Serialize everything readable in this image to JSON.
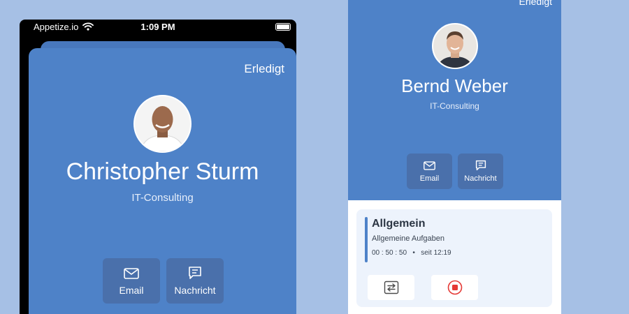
{
  "left_phone": {
    "status_bar": {
      "carrier": "Appetize.io",
      "time": "1:09 PM"
    },
    "done_label": "Erledigt",
    "contact": {
      "name": "Christopher Sturm",
      "department": "IT-Consulting"
    },
    "actions": {
      "email_label": "Email",
      "message_label": "Nachricht"
    }
  },
  "right_phone": {
    "done_label": "Erledigt",
    "contact": {
      "name": "Bernd Weber",
      "department": "IT-Consulting"
    },
    "actions": {
      "email_label": "Email",
      "message_label": "Nachricht"
    },
    "task": {
      "title": "Allgemein",
      "subtitle": "Allgemeine Aufgaben",
      "duration": "00 : 50 : 50",
      "separator": "•",
      "since": "seit 12:19"
    }
  },
  "colors": {
    "background": "#a6c0e5",
    "header_blue": "#4e82c8",
    "button_blue": "#4a70ab",
    "stop_red": "#e53935"
  },
  "icons": [
    "wifi-icon",
    "battery-icon",
    "mail-icon",
    "message-icon",
    "switch-icon",
    "stop-icon"
  ]
}
